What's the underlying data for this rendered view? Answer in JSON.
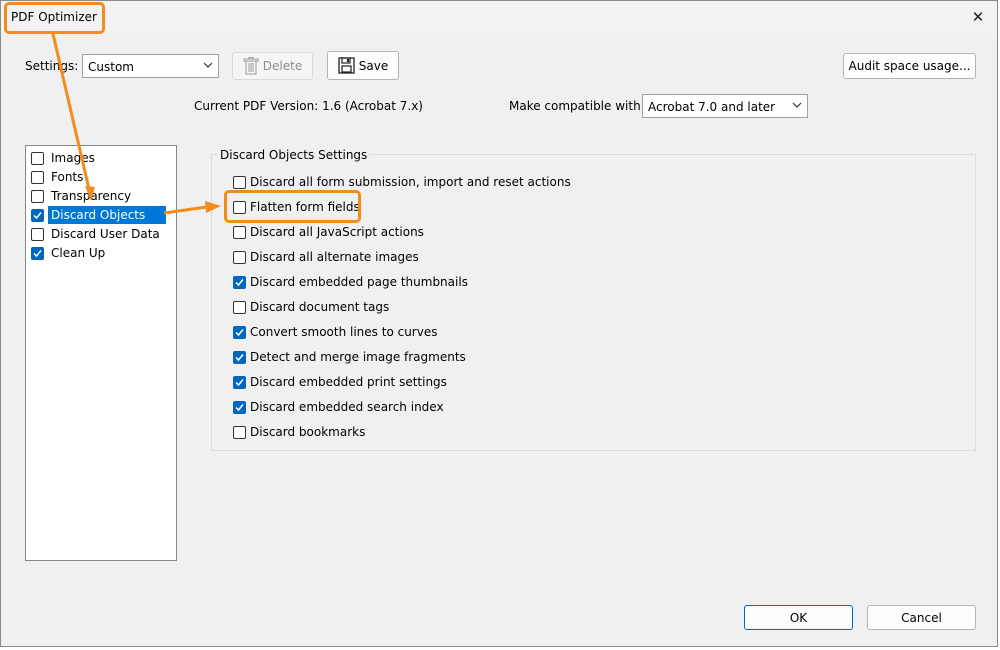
{
  "window": {
    "title": "PDF Optimizer",
    "close_glyph": "✕"
  },
  "toolbar": {
    "settings_label": "Settings:",
    "settings_value": "Custom",
    "delete_label": "Delete",
    "save_label": "Save",
    "audit_label": "Audit space usage..."
  },
  "version": {
    "current_label": "Current PDF Version: 1.6 (Acrobat 7.x)",
    "compat_label": "Make compatible with:",
    "compat_value": "Acrobat 7.0 and later"
  },
  "panels": [
    {
      "label": "Images",
      "checked": false,
      "selected": false
    },
    {
      "label": "Fonts",
      "checked": false,
      "selected": false
    },
    {
      "label": "Transparency",
      "checked": false,
      "selected": false
    },
    {
      "label": "Discard Objects",
      "checked": true,
      "selected": true
    },
    {
      "label": "Discard User Data",
      "checked": false,
      "selected": false
    },
    {
      "label": "Clean Up",
      "checked": true,
      "selected": false
    }
  ],
  "discard_group": {
    "title": "Discard Objects Settings",
    "options": [
      {
        "label": "Discard all form submission, import and reset actions",
        "checked": false
      },
      {
        "label": "Flatten form fields",
        "checked": false
      },
      {
        "label": "Discard all JavaScript actions",
        "checked": false
      },
      {
        "label": "Discard all alternate images",
        "checked": false
      },
      {
        "label": "Discard embedded page thumbnails",
        "checked": true
      },
      {
        "label": "Discard document tags",
        "checked": false
      },
      {
        "label": "Convert smooth lines to curves",
        "checked": true
      },
      {
        "label": "Detect and merge image fragments",
        "checked": true
      },
      {
        "label": "Discard embedded print settings",
        "checked": true
      },
      {
        "label": "Discard embedded search index",
        "checked": true
      },
      {
        "label": "Discard bookmarks",
        "checked": false
      }
    ]
  },
  "footer": {
    "ok_label": "OK",
    "cancel_label": "Cancel"
  },
  "colors": {
    "accent": "#0067c0",
    "highlight": "#f28c1c",
    "selection": "#0078d7"
  }
}
